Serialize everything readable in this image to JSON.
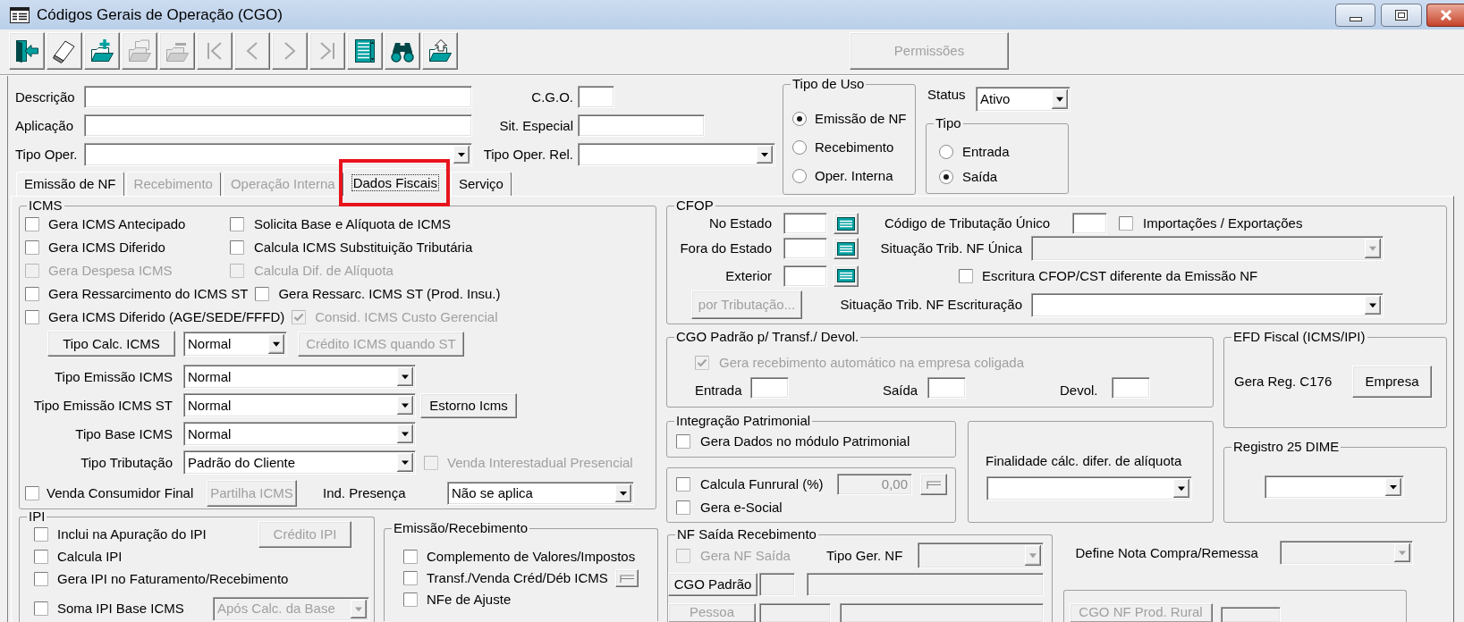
{
  "window": {
    "title": "Códigos Gerais de Operação (CGO)"
  },
  "toolbar": {
    "buttons": [
      {
        "kind": "exit",
        "disabled": false
      },
      {
        "kind": "eraser",
        "disabled": false
      },
      {
        "kind": "folder-plus",
        "disabled": false
      },
      {
        "kind": "folder",
        "disabled": true
      },
      {
        "kind": "folder-minus",
        "disabled": true
      },
      {
        "kind": "first",
        "disabled": true
      },
      {
        "kind": "previous",
        "disabled": true
      },
      {
        "kind": "next",
        "disabled": true
      },
      {
        "kind": "last",
        "disabled": true
      },
      {
        "kind": "list",
        "disabled": false
      },
      {
        "kind": "binoculars",
        "disabled": false
      },
      {
        "kind": "folder-up",
        "disabled": false
      }
    ],
    "permissions": {
      "label": "Permissões",
      "disabled": true
    }
  },
  "header": {
    "descricao": {
      "label": "Descrição"
    },
    "aplicacao": {
      "label": "Aplicação"
    },
    "tipo_oper": {
      "label": "Tipo Oper."
    },
    "cgo": {
      "label": "C.G.O."
    },
    "sit_especial": {
      "label": "Sit. Especial"
    },
    "tipo_oper_rel": {
      "label": "Tipo Oper. Rel."
    },
    "tipo_de_uso": {
      "title": "Tipo de Uso",
      "options": [
        {
          "label": "Emissão de NF",
          "selected": true
        },
        {
          "label": "Recebimento",
          "selected": false
        },
        {
          "label": "Oper. Interna",
          "selected": false
        }
      ]
    },
    "status": {
      "label": "Status",
      "value": "Ativo"
    },
    "tipo": {
      "title": "Tipo",
      "options": [
        {
          "label": "Entrada",
          "selected": false
        },
        {
          "label": "Saída",
          "selected": true
        }
      ]
    }
  },
  "tabs": [
    {
      "label": "Emissão de NF",
      "selected": false,
      "disabled": false,
      "highlighted": false
    },
    {
      "label": "Recebimento",
      "selected": false,
      "disabled": true,
      "highlighted": false
    },
    {
      "label": "Operação Interna",
      "selected": false,
      "disabled": true,
      "highlighted": false
    },
    {
      "label": "Dados Fiscais",
      "selected": true,
      "disabled": false,
      "highlighted": true
    },
    {
      "label": "Serviço",
      "selected": false,
      "disabled": false,
      "highlighted": false
    }
  ],
  "icms": {
    "title": "ICMS",
    "check_rows": [
      {
        "kind": "columns",
        "items": [
          {
            "label": "Gera ICMS Antecipado",
            "checked": false,
            "disabled": false
          },
          {
            "label": "Solicita Base e Alíquota de ICMS",
            "checked": false,
            "disabled": false
          }
        ]
      },
      {
        "kind": "columns",
        "items": [
          {
            "label": "Gera ICMS Diferido",
            "checked": false,
            "disabled": false
          },
          {
            "label": "Calcula ICMS Substituição Tributária",
            "checked": false,
            "disabled": false
          }
        ]
      },
      {
        "kind": "columns",
        "items": [
          {
            "label": "Gera Despesa ICMS",
            "checked": false,
            "disabled": true
          },
          {
            "label": "Calcula Dif. de Alíquota",
            "checked": false,
            "disabled": true
          }
        ]
      },
      {
        "kind": "inline",
        "items": [
          {
            "label": "Gera Ressarcimento do ICMS ST",
            "checked": false,
            "disabled": false
          },
          {
            "label": "Gera Ressarc. ICMS ST (Prod. Insu.)",
            "checked": false,
            "disabled": false
          }
        ]
      },
      {
        "kind": "inline",
        "items": [
          {
            "label": "Gera ICMS Diferido (AGE/SEDE/FFFD)",
            "checked": false,
            "disabled": false
          },
          {
            "label": "Consid. ICMS Custo Gerencial",
            "checked": true,
            "disabled": true
          }
        ]
      }
    ],
    "calc": {
      "button": {
        "label": "Tipo Calc. ICMS",
        "disabled": false
      },
      "value": "Normal",
      "credit_button": {
        "label": "Crédito ICMS quando ST",
        "disabled": true
      }
    },
    "selects": [
      {
        "label": "Tipo Emissão ICMS",
        "value": "Normal"
      },
      {
        "label": "Tipo Emissão ICMS ST",
        "value": "Normal",
        "extra": {
          "kind": "button",
          "label": "Estorno Icms",
          "disabled": false
        }
      },
      {
        "label": "Tipo Base ICMS",
        "value": "Normal"
      },
      {
        "label": "Tipo Tributação",
        "value": "Padrão do Cliente",
        "extra": {
          "kind": "checkbox",
          "label": "Venda Interestadual Presencial",
          "checked": false,
          "disabled": true
        }
      }
    ],
    "consumer": {
      "checkbox": {
        "label": "Venda Consumidor Final",
        "checked": false,
        "disabled": false
      },
      "button": {
        "label": "Partilha ICMS",
        "disabled": true
      },
      "presence": {
        "label": "Ind. Presença",
        "value": "Não se aplica"
      }
    }
  },
  "ipi": {
    "title": "IPI",
    "items": [
      {
        "label": "Inclui na Apuração do IPI",
        "checked": false,
        "disabled": false
      },
      {
        "label": "Calcula IPI",
        "checked": false,
        "disabled": false
      },
      {
        "label": "Gera IPI no Faturamento/Recebimento",
        "checked": false,
        "disabled": false
      },
      {
        "label": "Soma IPI Base ICMS",
        "checked": false,
        "disabled": false
      }
    ],
    "credit_button": {
      "label": "Crédito IPI",
      "disabled": true
    },
    "base_select": {
      "value": "Após Calc. da Base",
      "disabled": true
    }
  },
  "emissao_recebimento": {
    "title": "Emissão/Recebimento",
    "items": [
      {
        "kind": "plain",
        "label": "Complemento de Valores/Impostos",
        "checked": false,
        "disabled": false
      },
      {
        "kind": "with-button",
        "label": "Transf./Venda Créd/Déb ICMS",
        "checked": false,
        "disabled": false
      },
      {
        "kind": "plain",
        "label": "NFe de Ajuste",
        "checked": false,
        "disabled": false
      }
    ]
  },
  "cfop": {
    "title": "CFOP",
    "codes": [
      {
        "label": "No Estado"
      },
      {
        "label": "Fora do Estado"
      },
      {
        "label": "Exterior"
      }
    ],
    "by_tax_button": {
      "label": "por Tributação...",
      "disabled": true
    },
    "single_code": {
      "label": "Código de Tributação Único"
    },
    "import_export": {
      "label": "Importações / Exportações",
      "checked": false,
      "disabled": false
    },
    "sit_unica": {
      "label": "Situação Trib. NF Única",
      "disabled": true
    },
    "escritura": {
      "label": "Escritura CFOP/CST diferente da Emissão NF",
      "checked": false,
      "disabled": false
    },
    "sit_escrituracao": {
      "label": "Situação Trib. NF Escrituração",
      "disabled": false
    }
  },
  "cgo_padrao": {
    "title": "CGO Padrão p/ Transf./ Devol.",
    "auto_receive": {
      "label": "Gera recebimento automático na empresa coligada",
      "checked": true,
      "disabled": true
    },
    "fields": [
      {
        "label": "Entrada"
      },
      {
        "label": "Saída"
      },
      {
        "label": "Devol."
      }
    ]
  },
  "efd": {
    "title": "EFD Fiscal (ICMS/IPI)",
    "label": "Gera Reg. C176",
    "button": {
      "label": "Empresa",
      "disabled": false
    }
  },
  "integracao": {
    "title": "Integração Patrimonial",
    "checkbox": {
      "label": "Gera Dados no módulo Patrimonial",
      "checked": false,
      "disabled": false
    }
  },
  "funrural": {
    "checkbox": {
      "label": "Calcula Funrural (%)",
      "checked": false,
      "disabled": false
    },
    "field": {
      "value": "0,00",
      "disabled": true
    },
    "social": {
      "label": "Gera e-Social",
      "checked": false,
      "disabled": false
    }
  },
  "finalidade": {
    "label": "Finalidade cálc. difer. de alíquota"
  },
  "dime": {
    "title": "Registro 25 DIME"
  },
  "nf_saida": {
    "title": "NF Saída Recebimento",
    "generate": {
      "label": "Gera NF Saída",
      "checked": false,
      "disabled": true
    },
    "type_label": "Tipo Ger. NF",
    "type_select": {
      "disabled": true
    },
    "cgo_button": {
      "label": "CGO Padrão",
      "disabled": false
    },
    "person_button": {
      "label": "Pessoa",
      "disabled": true
    },
    "inputs_disabled": true
  },
  "define_nota": {
    "label": "Define Nota Compra/Remessa",
    "disabled": true
  },
  "rural": {
    "button": {
      "label": "CGO NF Prod. Rural",
      "disabled": true
    },
    "input_disabled": true
  }
}
